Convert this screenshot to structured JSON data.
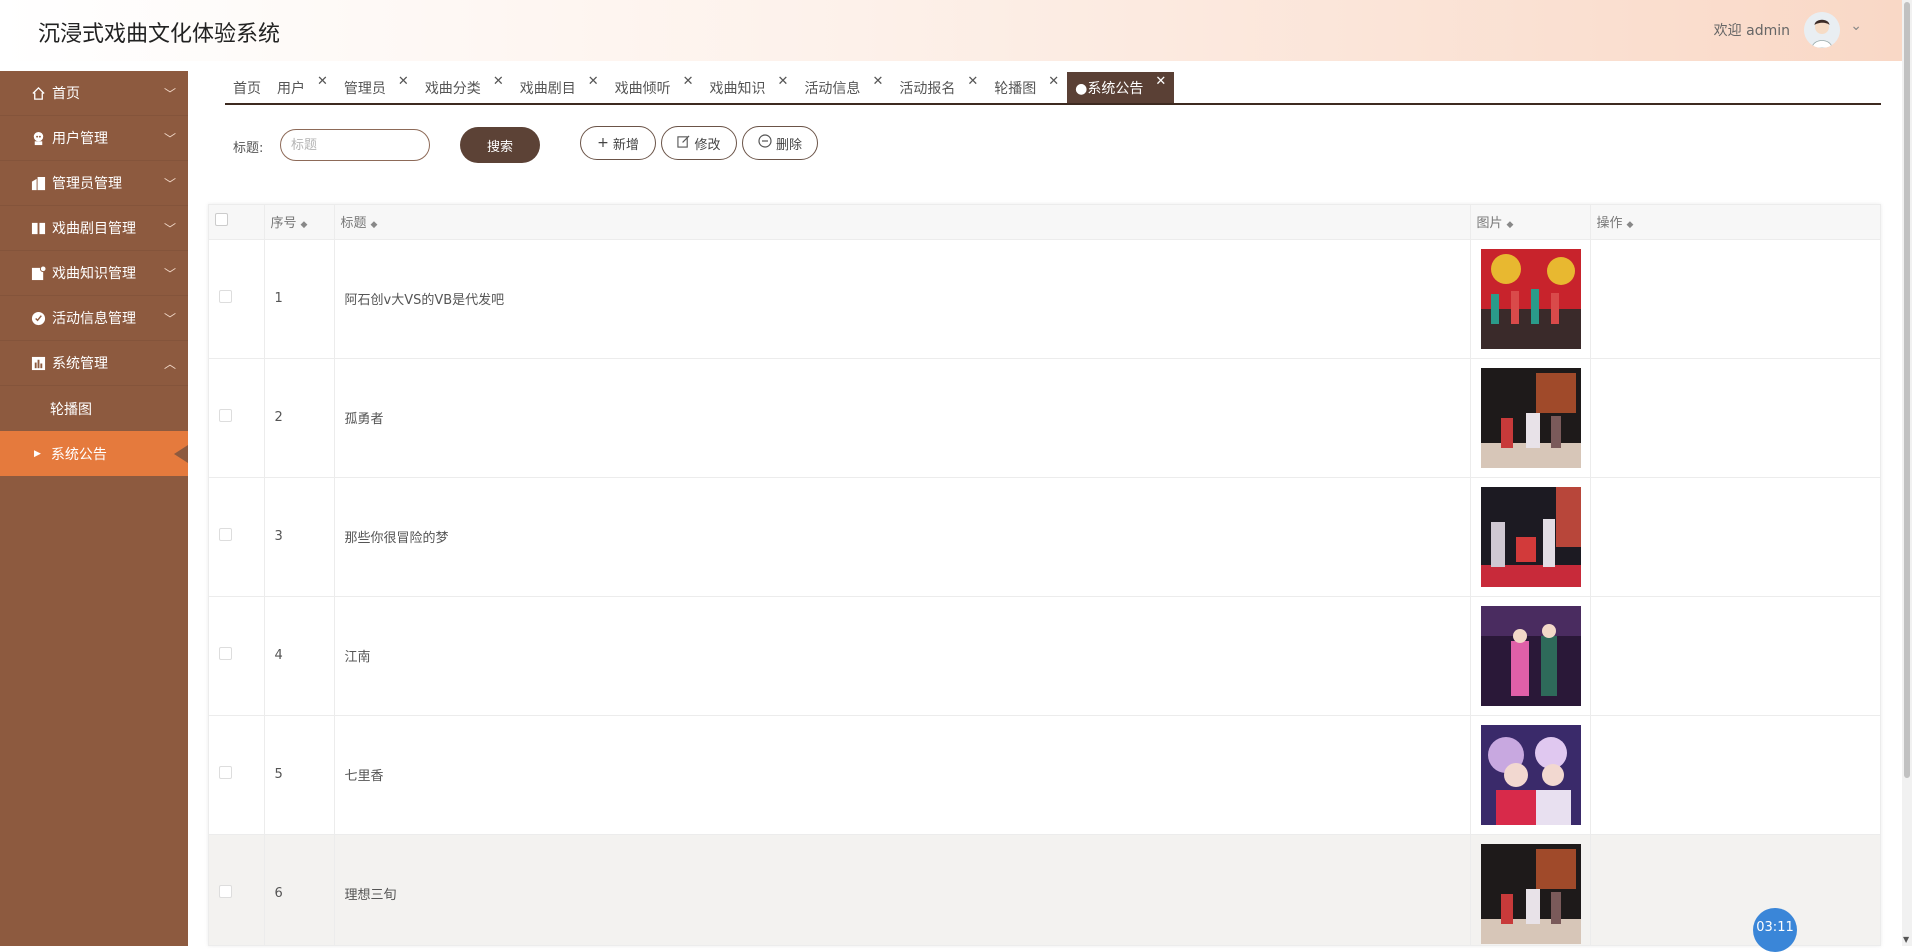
{
  "header": {
    "title": "沉浸式戏曲文化体验系统",
    "welcome": "欢迎 admin"
  },
  "sidebar": {
    "items": [
      {
        "label": "首页",
        "icon": "home-icon"
      },
      {
        "label": "用户管理",
        "icon": "user-icon"
      },
      {
        "label": "管理员管理",
        "icon": "admin-icon"
      },
      {
        "label": "戏曲剧目管理",
        "icon": "book-icon"
      },
      {
        "label": "戏曲知识管理",
        "icon": "doc-icon"
      },
      {
        "label": "活动信息管理",
        "icon": "check-icon"
      },
      {
        "label": "系统管理",
        "icon": "chart-icon"
      }
    ],
    "sub_items": [
      {
        "label": "轮播图"
      },
      {
        "label": "系统公告"
      }
    ]
  },
  "tabs": [
    "首页",
    "用户",
    "管理员",
    "戏曲分类",
    "戏曲剧目",
    "戏曲倾听",
    "戏曲知识",
    "活动信息",
    "活动报名",
    "轮播图",
    "●系统公告"
  ],
  "search": {
    "label": "标题:",
    "placeholder": "标题",
    "button": "搜索"
  },
  "actions": {
    "add": "新增",
    "edit": "修改",
    "delete": "删除"
  },
  "table": {
    "headers": {
      "index": "序号",
      "title": "标题",
      "image": "图片",
      "ops": "操作"
    },
    "rows": [
      {
        "index": "1",
        "title": "阿石创v大VS的VB是代发吧"
      },
      {
        "index": "2",
        "title": "孤勇者"
      },
      {
        "index": "3",
        "title": "那些你很冒险的梦"
      },
      {
        "index": "4",
        "title": "江南"
      },
      {
        "index": "5",
        "title": "七里香"
      },
      {
        "index": "6",
        "title": "理想三旬"
      }
    ]
  },
  "timer": "03:11",
  "colors": {
    "sidebar": "#8d5a3f",
    "sidebar_active": "#e57a3d",
    "primary_button": "#5c4236",
    "active_tab": "#5a4035",
    "timer": "#3a86d8"
  }
}
